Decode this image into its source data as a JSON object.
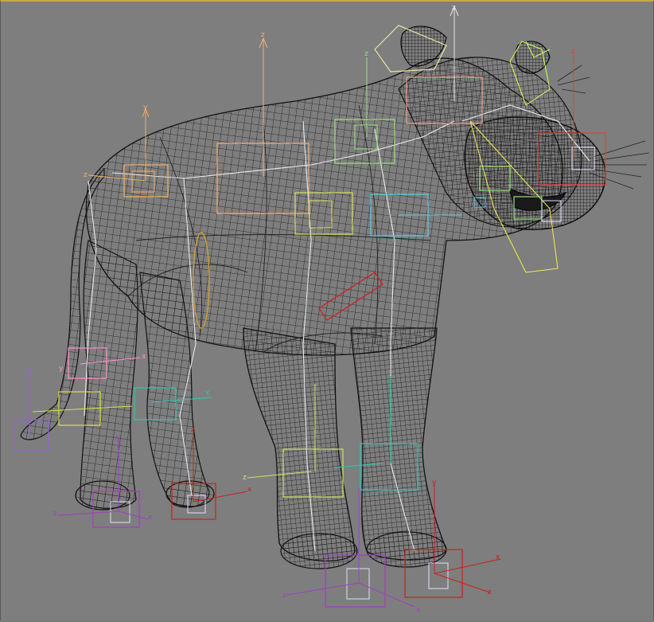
{
  "viewport": {
    "background": "#7e7e7e",
    "frame_color": "#caa84a",
    "mesh_color": "#111111"
  },
  "axis_labels": {
    "z": "z",
    "y": "y",
    "x": "x"
  },
  "gizmos": [
    {
      "id": "head-top",
      "color": "#e6e6a0"
    },
    {
      "id": "spine",
      "color": "#f0b080"
    },
    {
      "id": "shoulder",
      "color": "#9be07a"
    },
    {
      "id": "jaw",
      "color": "#ff6060"
    },
    {
      "id": "hip",
      "color": "#f2b060"
    },
    {
      "id": "chest",
      "color": "#d8e060"
    },
    {
      "id": "neck",
      "color": "#60c8e8"
    },
    {
      "id": "tail-1",
      "color": "#ff90d0"
    },
    {
      "id": "tail-2",
      "color": "#d8e040"
    },
    {
      "id": "tail-tip",
      "color": "#9a60e0"
    },
    {
      "id": "back-leg-left",
      "color": "#30c8b0"
    },
    {
      "id": "front-leg-left",
      "color": "#d0e060"
    },
    {
      "id": "front-leg-right",
      "color": "#30c8b0"
    },
    {
      "id": "foot-back-left",
      "color": "#a040c0"
    },
    {
      "id": "foot-back-right",
      "color": "#cc2020"
    },
    {
      "id": "foot-front-left",
      "color": "#a040c0"
    },
    {
      "id": "foot-front-right",
      "color": "#cc2020"
    }
  ]
}
